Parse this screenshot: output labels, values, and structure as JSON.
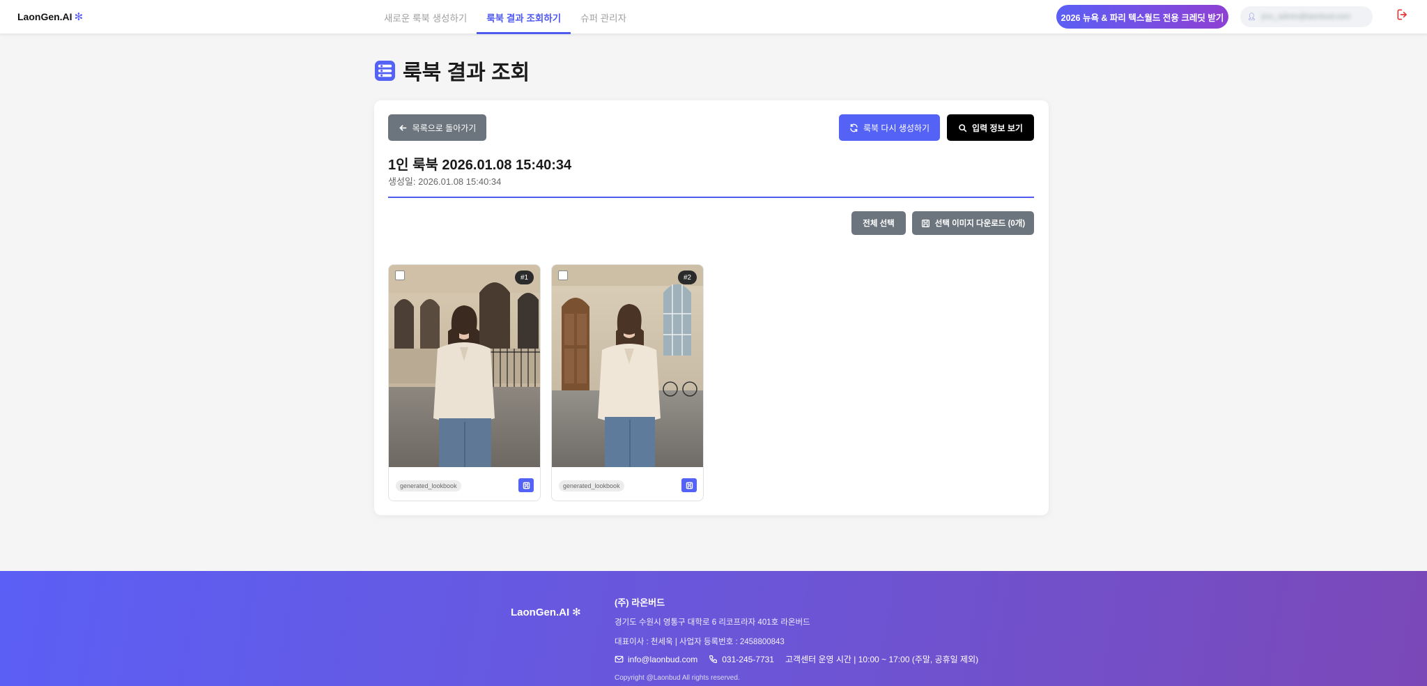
{
  "header": {
    "logo_text": "LaonGen.AI",
    "nav": [
      {
        "label": "새로운 룩북 생성하기",
        "active": false
      },
      {
        "label": "룩북 결과 조회하기",
        "active": true
      },
      {
        "label": "슈퍼 관리자",
        "active": false
      }
    ],
    "credit_button": "2026 뉴욕 & 파리 텍스월드 전용 크레딧 받기",
    "user_email": "jinu_admin@laonbud.com"
  },
  "page": {
    "title": "룩북 결과 조회"
  },
  "card": {
    "back_button": "목록으로 돌아가기",
    "regenerate_button": "룩북 다시 생성하기",
    "input_info_button": "입력 정보 보기",
    "lookbook_title": "1인 룩북 2026.01.08 15:40:34",
    "created_at": "생성일: 2026.01.08 15:40:34",
    "select_all_button": "전체 선택",
    "download_button": "선택 이미지 다운로드 (0개)",
    "images": [
      {
        "number": "#1",
        "tag": "generated_lookbook"
      },
      {
        "number": "#2",
        "tag": "generated_lookbook"
      }
    ]
  },
  "footer": {
    "logo_text": "LaonGen.AI",
    "company": "(주) 라온버드",
    "address": "경기도 수원시 영통구 대학로 6 리코프라자 401호 라온버드",
    "registration": "대표이사 : 천세욱 | 사업자 등록번호 : 2458800843",
    "email": "info@laonbud.com",
    "phone": "031-245-7731",
    "hours": "고객센터 운영 시간 | 10:00 ~ 17:00 (주말, 공휴일 제외)",
    "copyright": "Copyright @Laonbud All rights reserved."
  },
  "colors": {
    "accent": "#4f5af0",
    "gray_button": "#6c757d",
    "footer_gradient_start": "#5b5ff5",
    "footer_gradient_end": "#7b48b8"
  }
}
